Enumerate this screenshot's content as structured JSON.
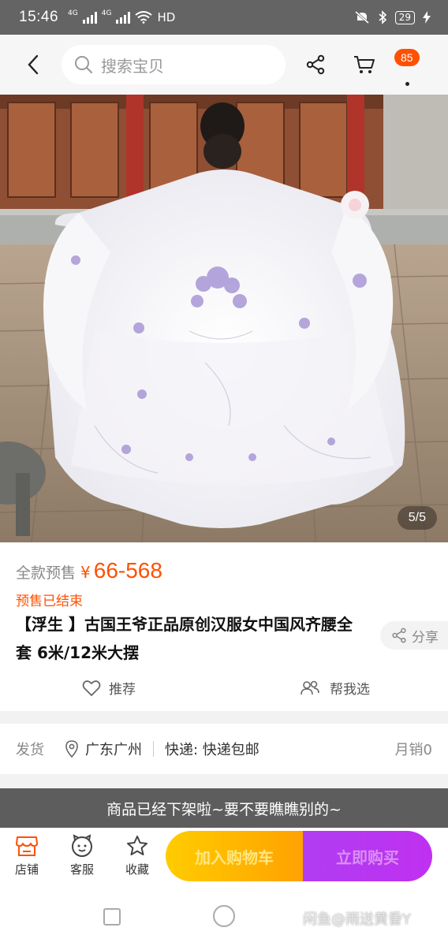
{
  "status_bar": {
    "time": "15:46",
    "net1": "4G",
    "net2": "4G",
    "hd": "HD",
    "battery": "29"
  },
  "search": {
    "placeholder": "搜索宝贝"
  },
  "header": {
    "message_count": "85"
  },
  "gallery": {
    "counter": "5/5"
  },
  "product": {
    "price_label": "全款预售",
    "currency": "¥",
    "price": "66-568",
    "presale_status": "预售已结束",
    "title": "【浮生 】古国王爷正品原创汉服女中国风齐腰全套 6米/12米大摆",
    "share_label": "分享",
    "recommend_label": "推荐",
    "help_choose_label": "帮我选"
  },
  "shipping": {
    "label": "发货",
    "location": "广东广州",
    "delivery": "快递: 快递包邮",
    "monthly_sales": "月销0"
  },
  "banner": {
    "offline_text": "商品已经下架啦~要不要瞧瞧别的~"
  },
  "bottom_bar": {
    "store_label": "店铺",
    "service_label": "客服",
    "favorite_label": "收藏",
    "add_to_cart_label": "加入购物车",
    "buy_now_label": "立即购买"
  },
  "watermark": "闲鱼@雨送黄昏Y",
  "colors": {
    "accent": "#ff5000",
    "cart_gradient": "#ffb300",
    "buy_gradient": "#b83af2"
  }
}
